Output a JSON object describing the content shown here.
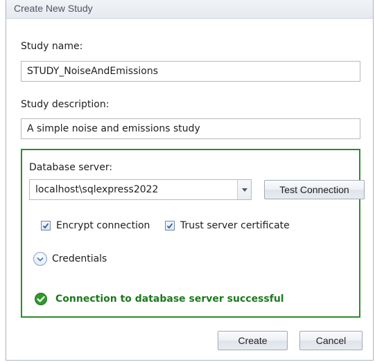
{
  "window": {
    "title": "Create New Study"
  },
  "study_name": {
    "label": "Study name:",
    "value": "STUDY_NoiseAndEmissions"
  },
  "study_description": {
    "label": "Study description:",
    "value": "A simple noise and emissions study"
  },
  "database": {
    "label": "Database server:",
    "server_value": "localhost\\sqlexpress2022",
    "test_button": "Test Connection",
    "encrypt": {
      "label": "Encrypt connection",
      "checked": true
    },
    "trust_cert": {
      "label": "Trust server certificate",
      "checked": true
    },
    "credentials_label": "Credentials",
    "status_text": "Connection to database server successful",
    "status_color": "#1c7a1c",
    "status_icon": "check-circle-icon"
  },
  "footer": {
    "create_label": "Create",
    "cancel_label": "Cancel"
  },
  "colors": {
    "group_border": "#2a8c2a",
    "accent": "#4a78b4"
  }
}
